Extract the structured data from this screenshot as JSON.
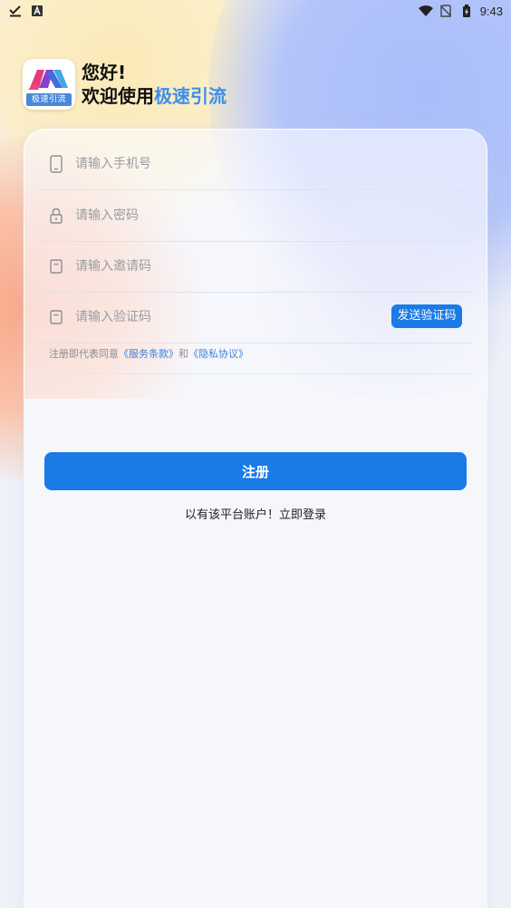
{
  "status_bar": {
    "time": "9:43",
    "left_icons": [
      "download-done-icon",
      "font-a-icon"
    ],
    "right_icons": [
      "wifi-icon",
      "no-sim-icon",
      "battery-charging-icon"
    ]
  },
  "header": {
    "logo_label": "极速引流",
    "greeting": "您好!",
    "welcome_prefix": "欢迎使用",
    "brand_name": "极速引流"
  },
  "form": {
    "phone": {
      "placeholder": "请输入手机号",
      "value": "",
      "icon": "phone-icon"
    },
    "password": {
      "placeholder": "请输入密码",
      "value": "",
      "icon": "lock-icon"
    },
    "invite_code": {
      "placeholder": "请输入邀请码",
      "value": "",
      "icon": "code-box-icon"
    },
    "verify_code": {
      "placeholder": "请输入验证码",
      "value": "",
      "icon": "code-box-icon"
    },
    "send_code_label": "发送验证码"
  },
  "agreement": {
    "prefix": "注册即代表同意",
    "terms": "《服务条款》",
    "and": "和",
    "privacy": "《隐私协议》"
  },
  "register_label": "注册",
  "login_prompt": "以有该平台账户！立即登录",
  "colors": {
    "accent": "#1a7ae6",
    "brand_text": "#3d8ee8",
    "link": "#3d82d6"
  }
}
